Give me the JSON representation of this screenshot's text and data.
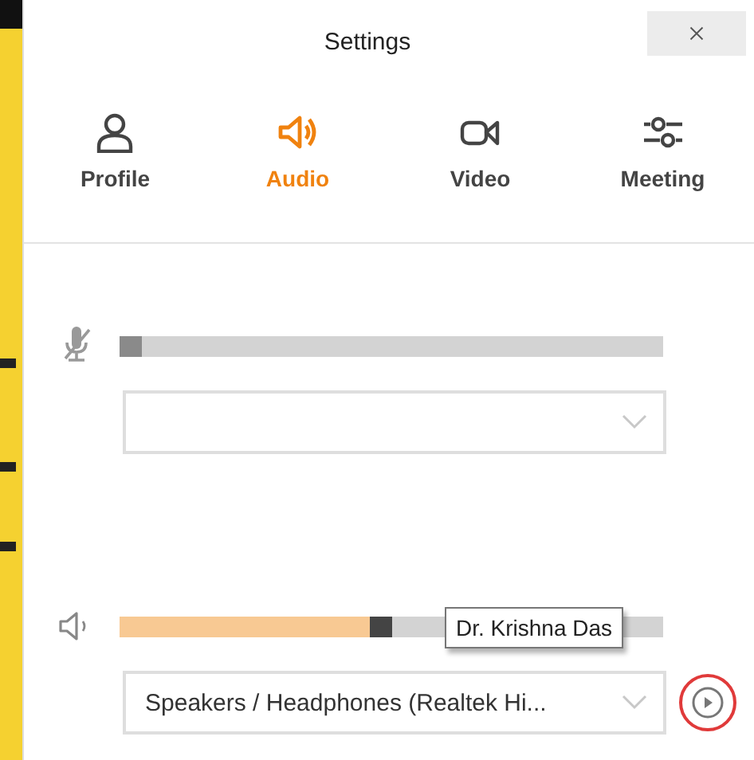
{
  "window": {
    "title": "Settings"
  },
  "tabs": [
    {
      "kind": "profile",
      "label": "Profile",
      "selected": false
    },
    {
      "kind": "audio",
      "label": "Audio",
      "selected": true
    },
    {
      "kind": "video",
      "label": "Video",
      "selected": false
    },
    {
      "kind": "meeting",
      "label": "Meeting",
      "selected": false
    }
  ],
  "microphone": {
    "muted": true,
    "level": 0
  },
  "speaker": {
    "level": 0.48,
    "device": "Speakers / Headphones (Realtek Hi...",
    "tooltip": "Dr. Krishna Das"
  }
}
